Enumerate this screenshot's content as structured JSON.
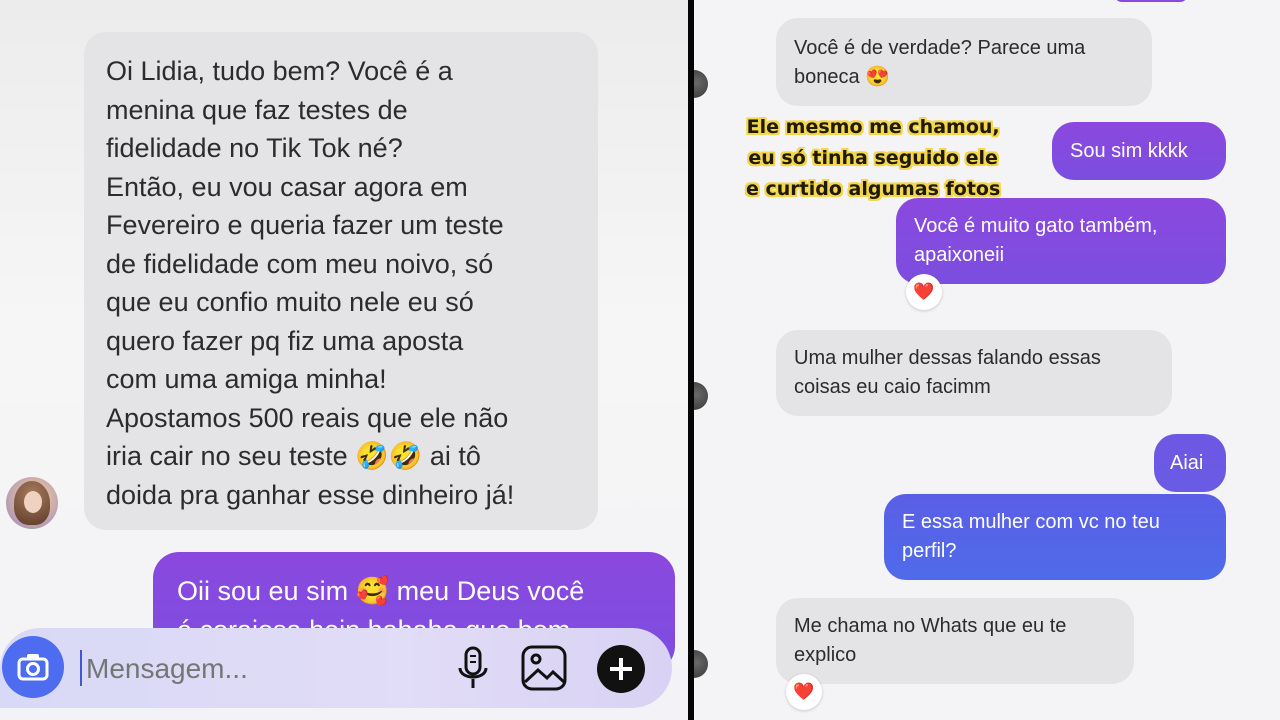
{
  "left": {
    "incoming_message": [
      "Oi Lidia, tudo bem? Você é a",
      "menina que faz testes de",
      "fidelidade no Tik Tok né?",
      "Então, eu vou casar agora em",
      "Fevereiro e queria fazer um teste",
      "de fidelidade com meu noivo, só",
      "que eu confio muito nele eu só",
      "quero fazer pq fiz uma aposta",
      "com uma amiga minha!",
      "Apostamos 500 reais que ele não",
      "iria cair no seu teste 🤣🤣 ai tô",
      "doida pra ganhar esse dinheiro já!"
    ],
    "outgoing_message": [
      "Oii sou eu sim 🥰 meu Deus você",
      "é corajosa hein hahaha que bom"
    ],
    "composer": {
      "placeholder": "Mensagem..."
    }
  },
  "right": {
    "caption": [
      "Ele mesmo me chamou,",
      "eu só tinha seguido ele",
      "e curtido algumas fotos"
    ],
    "messages": {
      "m1": [
        "Você é de verdade? Parece uma",
        "boneca 😍"
      ],
      "m2": [
        "Sou sim kkkk"
      ],
      "m3": [
        "Você é muito gato também,",
        "apaixoneii"
      ],
      "m4": [
        "Uma mulher dessas falando essas",
        "coisas eu caio facimm"
      ],
      "m5": [
        "Aiai"
      ],
      "m6": [
        "E essa mulher com vc no teu",
        "perfil?"
      ],
      "m7": [
        "Me chama no Whats que eu te",
        "explico"
      ]
    },
    "reactions": {
      "r1": "❤️",
      "r2": "❤️"
    }
  },
  "colors": {
    "sent_purple": "#8b48de",
    "sent_blue": "#4f6bea",
    "received": "#e4e4e6",
    "caption_yellow": "#f3d64a"
  }
}
